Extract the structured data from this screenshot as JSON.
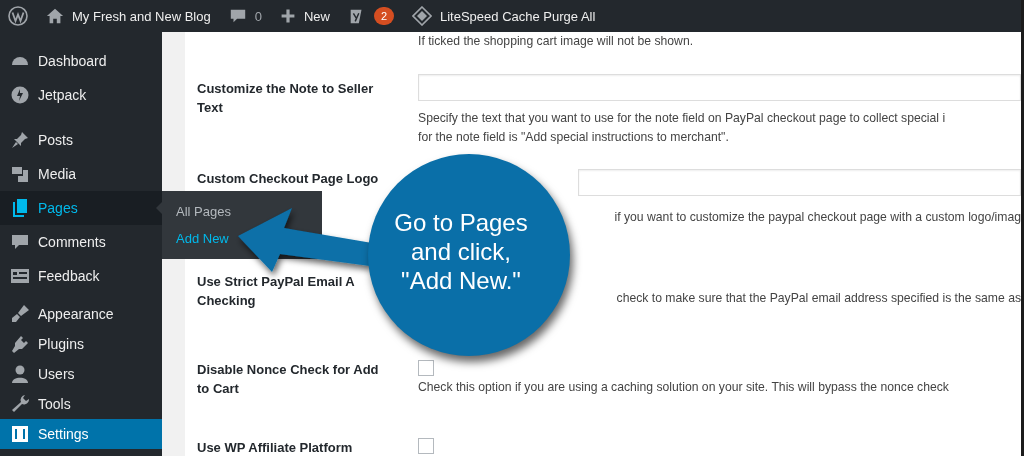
{
  "admin_bar": {
    "site_name": "My Fresh and New Blog",
    "comments_count": "0",
    "new_label": "New",
    "notifications_badge": "2",
    "cache_action": "LiteSpeed Cache Purge All"
  },
  "sidebar": {
    "groups": [
      [
        {
          "label": "Dashboard",
          "selected": false,
          "expanded": false
        },
        {
          "label": "Jetpack",
          "selected": false,
          "expanded": false
        }
      ],
      [
        {
          "label": "Posts",
          "selected": false,
          "expanded": false
        },
        {
          "label": "Media",
          "selected": false,
          "expanded": false
        },
        {
          "label": "Pages",
          "selected": false,
          "expanded": true,
          "submenu": [
            {
              "label": "All Pages",
              "selected": false
            },
            {
              "label": "Add New",
              "selected": true
            }
          ]
        },
        {
          "label": "Comments",
          "selected": false,
          "expanded": false
        },
        {
          "label": "Feedback",
          "selected": false,
          "expanded": false
        }
      ],
      [
        {
          "label": "Appearance",
          "selected": false,
          "expanded": false
        },
        {
          "label": "Plugins",
          "selected": false,
          "expanded": false
        },
        {
          "label": "Users",
          "selected": false,
          "expanded": false
        },
        {
          "label": "Tools",
          "selected": false,
          "expanded": false
        },
        {
          "label": "Settings",
          "selected": true,
          "expanded": false
        }
      ]
    ]
  },
  "settings": [
    {
      "kind": "note",
      "description": [
        "If ticked the shopping cart image will not be shown."
      ]
    },
    {
      "kind": "text",
      "label": "Customize the Note to Seller Text",
      "description": [
        "Specify the text that you want to use for the note field on PayPal checkout page to collect special i",
        "for the note field is \"Add special instructions to merchant\"."
      ]
    },
    {
      "kind": "text",
      "label": "Custom Checkout Page Logo",
      "description": [
        "if you want to customize the paypal checkout page with a custom logo/imag"
      ]
    },
    {
      "kind": "hidden",
      "label": "Use Strict PayPal Email A Checking",
      "description": [
        "check to make sure that the PayPal email address specified is the same as"
      ]
    },
    {
      "kind": "checkbox",
      "label": "Disable Nonce Check for Add to Cart",
      "checked": false,
      "description": [
        "Check this option if you are using a caching solution on your site. This will bypass the nonce check"
      ]
    },
    {
      "kind": "checkbox",
      "label": "Use WP Affiliate Platform",
      "checked": false
    }
  ],
  "callout": {
    "lines": [
      "Go to Pages",
      "and click,",
      "\"Add New.\""
    ]
  }
}
